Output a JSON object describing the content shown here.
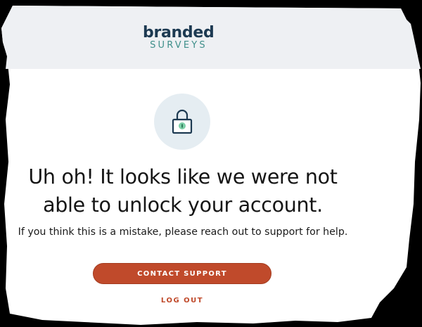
{
  "brand": {
    "top": "branded",
    "bottom": "SURVEYS"
  },
  "lock_icon": "lock-icon",
  "message": {
    "headline": "Uh oh! It looks like we were not able to unlock your account.",
    "subtext": "If you think this is a mistake, please reach out to support for help."
  },
  "actions": {
    "contact_support": "CONTACT SUPPORT",
    "log_out": "LOG OUT"
  },
  "colors": {
    "brand_navy": "#1d3a52",
    "brand_teal": "#3f8f8a",
    "accent": "#c04a2b",
    "header_bg": "#eef0f3"
  }
}
